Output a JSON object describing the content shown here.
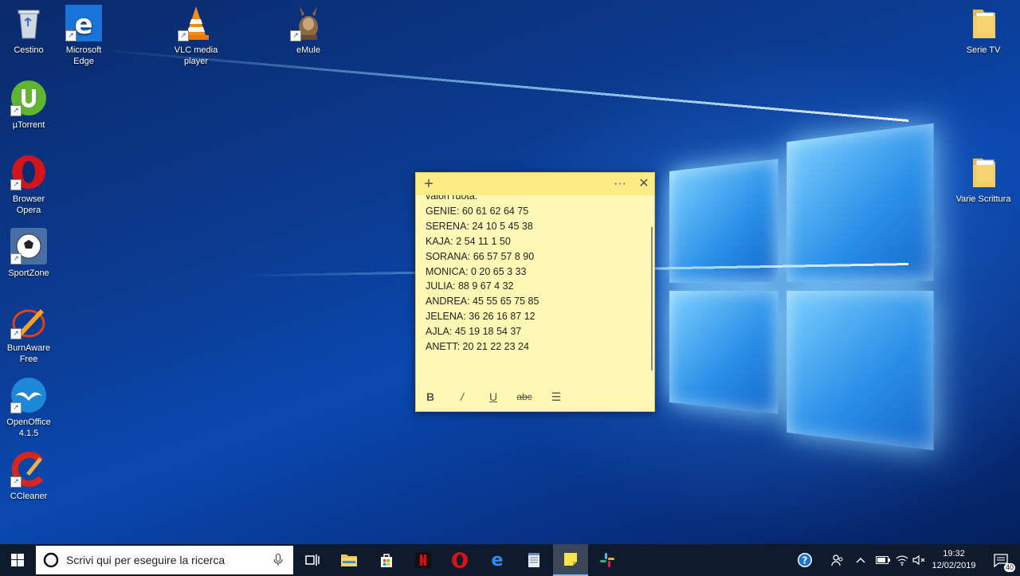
{
  "desktop": {
    "icons": [
      {
        "label": "Cestino"
      },
      {
        "label": "Microsoft Edge"
      },
      {
        "label": "VLC media player"
      },
      {
        "label": "eMule"
      },
      {
        "label": "µTorrent"
      },
      {
        "label": "Browser Opera"
      },
      {
        "label": "SportZone"
      },
      {
        "label": "BurnAware Free"
      },
      {
        "label": "OpenOffice 4.1.5"
      },
      {
        "label": "CCleaner"
      },
      {
        "label": "Serie TV"
      },
      {
        "label": "Varie Scrittura"
      }
    ]
  },
  "sticky_note": {
    "header": {
      "add_glyph": "+",
      "more_glyph": "···",
      "close_glyph": "✕"
    },
    "lines": [
      "valori ruota:",
      "GENIE: 60 61 62 64 75",
      "SERENA: 24 10 5 45 38",
      "KAJA: 2 54 11 1 50",
      "SORANA: 66 57 57 8 90",
      "MONICA: 0 20 65 3 33",
      "JULIA: 88 9 67 4 32",
      "ANDREA: 45 55 65 75 85",
      "JELENA: 36 26 16 87 12",
      "AJLA: 45 19 18 54 37",
      "ANETT: 20 21 22 23 24"
    ],
    "toolbar": {
      "bold": "B",
      "italic": "/",
      "underline": "U",
      "strike": "abc",
      "list": "☰"
    }
  },
  "taskbar": {
    "search_placeholder": "Scrivi qui per eseguire la ricerca",
    "clock_time": "19:32",
    "clock_date": "12/02/2019",
    "notification_count": "40"
  },
  "colors": {
    "note_bg": "#fff8b5",
    "note_header": "#fcec86",
    "taskbar": "#0f1a2c"
  }
}
